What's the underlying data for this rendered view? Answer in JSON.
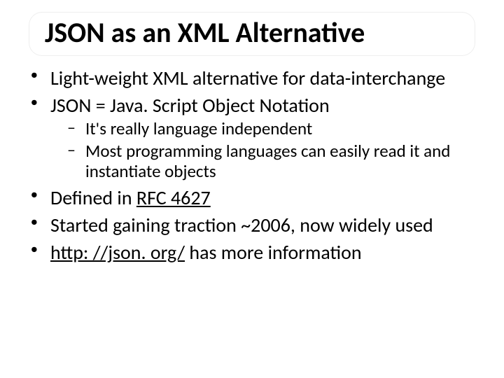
{
  "title": "JSON as an XML Alternative",
  "bullets": {
    "b1": " Light-weight XML alternative for data-interchange",
    "b2_pre": "JSON = Java. Script Object Notation",
    "b2_sub1": "It's really language independent",
    "b2_sub2": "Most programming languages can easily read it and instantiate objects",
    "b3_pre": "Defined in ",
    "b3_link": "RFC 4627",
    "b4": "Started gaining traction ~2006, now widely used",
    "b5_link": "http: //json. org/",
    "b5_post": " has more information"
  }
}
